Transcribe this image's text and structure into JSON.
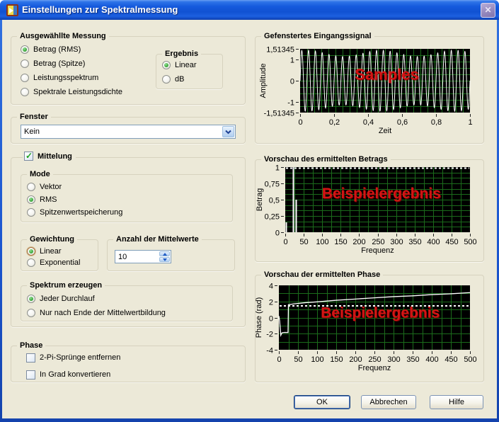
{
  "window": {
    "title": "Einstellungen zur Spektralmessung",
    "close_glyph": "✕"
  },
  "colors": {
    "titlebar_blue": "#1b55cf",
    "dialog_bg": "#ece9d8",
    "plot_bg": "#000000",
    "grid_green": "#1b6b1b",
    "trace_white": "#ffffff",
    "overlay_red": "#d41414",
    "control_border_blue": "#7f9db9",
    "radio_dot_green": "#2f9e2f",
    "check_green": "#1ea11e"
  },
  "left": {
    "messung": {
      "title": "Ausgewähllte Messung",
      "options": [
        {
          "label": "Betrag (RMS)",
          "selected": true
        },
        {
          "label": "Betrag (Spitze)",
          "selected": false
        },
        {
          "label": "Leistungsspektrum",
          "selected": false
        },
        {
          "label": "Spektrale Leistungsdichte",
          "selected": false
        }
      ]
    },
    "ergebnis": {
      "title": "Ergebnis",
      "options": [
        {
          "label": "Linear",
          "selected": true
        },
        {
          "label": "dB",
          "selected": false
        }
      ]
    },
    "fenster": {
      "title": "Fenster",
      "value": "Kein"
    },
    "mittelung": {
      "label": "Mittelung",
      "checked": true,
      "mode": {
        "title": "Mode",
        "options": [
          {
            "label": "Vektor",
            "selected": false
          },
          {
            "label": "RMS",
            "selected": true
          },
          {
            "label": "Spitzenwertspeicherung",
            "selected": false
          }
        ]
      },
      "gewichtung": {
        "title": "Gewichtung",
        "options": [
          {
            "label": "Linear",
            "selected": true,
            "focused": true
          },
          {
            "label": "Exponential",
            "selected": false
          }
        ]
      },
      "anzahl": {
        "title": "Anzahl der Mittelwerte",
        "value": "10"
      },
      "spektrum": {
        "title": "Spektrum erzeugen",
        "options": [
          {
            "label": "Jeder Durchlauf",
            "selected": true
          },
          {
            "label": "Nur nach Ende der Mittelwertbildung",
            "selected": false
          }
        ]
      }
    },
    "phase": {
      "title": "Phase",
      "options": [
        {
          "label": "2-Pi-Sprünge entfernen",
          "checked": false
        },
        {
          "label": "In Grad konvertieren",
          "checked": false
        }
      ]
    }
  },
  "buttons": {
    "ok": "OK",
    "cancel": "Abbrechen",
    "help": "Hilfe"
  },
  "chart_data": [
    {
      "type": "line",
      "title": "Gefenstertes Eingangssignal",
      "xlabel": "Zeit",
      "ylabel": "Amplitude",
      "xlim": [
        0,
        1
      ],
      "ylim": [
        -1.51345,
        1.51345
      ],
      "xticks": [
        [
          0,
          "0"
        ],
        [
          0.2,
          "0,2"
        ],
        [
          0.4,
          "0,4"
        ],
        [
          0.6,
          "0,6"
        ],
        [
          0.8,
          "0,8"
        ],
        [
          1,
          "1"
        ]
      ],
      "yticks": [
        [
          1.51345,
          "1,51345"
        ],
        [
          1,
          "1"
        ],
        [
          0,
          "0"
        ],
        [
          -1,
          "-1"
        ],
        [
          -1.51345,
          "-1,51345"
        ]
      ],
      "grid": {
        "nx": 24,
        "ny": 10,
        "on": true
      },
      "legend": false,
      "series": [
        {
          "name": "windowed-signal",
          "gen": "sine",
          "cycles": 25,
          "amplitude": 1.3,
          "beat_amp": 0.15,
          "beat_cycles": 2.3,
          "samples": 720
        }
      ],
      "overlay": {
        "text": "Samples",
        "fx": 0.51,
        "fy": 0.4,
        "size": 22
      }
    },
    {
      "type": "line",
      "title": "Vorschau des ermittelten Betrags",
      "xlabel": "Frequenz",
      "ylabel": "Betrag",
      "xlim": [
        0,
        500
      ],
      "ylim": [
        0,
        1
      ],
      "xticks": [
        [
          0,
          "0"
        ],
        [
          50,
          "50"
        ],
        [
          100,
          "100"
        ],
        [
          150,
          "150"
        ],
        [
          200,
          "200"
        ],
        [
          250,
          "250"
        ],
        [
          300,
          "300"
        ],
        [
          350,
          "350"
        ],
        [
          400,
          "400"
        ],
        [
          450,
          "450"
        ],
        [
          500,
          "500"
        ]
      ],
      "yticks": [
        [
          1,
          "1"
        ],
        [
          0.75,
          "0,75"
        ],
        [
          0.5,
          "0,5"
        ],
        [
          0.25,
          "0,25"
        ],
        [
          0,
          "0"
        ]
      ],
      "grid": {
        "nx": 20,
        "ny": 12,
        "on": true
      },
      "legend": false,
      "series": [
        {
          "name": "betrag-spektrum",
          "gen": "spikes",
          "spikes": [
            [
              3,
              0.15
            ],
            [
              22,
              1.0
            ],
            [
              30,
              0.5
            ]
          ]
        },
        {
          "name": "referenzlinie",
          "gen": "hline",
          "y": 1.0,
          "style": "dotted"
        }
      ],
      "overlay": {
        "text": "Beispielergebnis",
        "fx": 0.52,
        "fy": 0.4,
        "size": 21
      }
    },
    {
      "type": "line",
      "title": "Vorschau der ermittelten Phase",
      "xlabel": "Frequenz",
      "ylabel": "Phase (rad)",
      "xlim": [
        0,
        500
      ],
      "ylim": [
        -4,
        4
      ],
      "xticks": [
        [
          0,
          "0"
        ],
        [
          50,
          "50"
        ],
        [
          100,
          "100"
        ],
        [
          150,
          "150"
        ],
        [
          200,
          "200"
        ],
        [
          250,
          "250"
        ],
        [
          300,
          "300"
        ],
        [
          350,
          "350"
        ],
        [
          400,
          "400"
        ],
        [
          450,
          "450"
        ],
        [
          500,
          "500"
        ]
      ],
      "yticks": [
        [
          4,
          "4"
        ],
        [
          2,
          "2"
        ],
        [
          0,
          "0"
        ],
        [
          -2,
          "-2"
        ],
        [
          -4,
          "-4"
        ]
      ],
      "grid": {
        "nx": 20,
        "ny": 8,
        "on": true
      },
      "legend": false,
      "series": [
        {
          "name": "phase",
          "gen": "points",
          "points": [
            [
              0,
              0.2
            ],
            [
              2,
              -0.4
            ],
            [
              5,
              -2.2
            ],
            [
              8,
              -1.9
            ],
            [
              14,
              -1.85
            ],
            [
              24,
              -1.85
            ],
            [
              25,
              1.6
            ],
            [
              40,
              1.7
            ],
            [
              70,
              1.85
            ],
            [
              100,
              1.95
            ],
            [
              150,
              2.15
            ],
            [
              200,
              2.3
            ],
            [
              250,
              2.45
            ],
            [
              300,
              2.6
            ],
            [
              350,
              2.7
            ],
            [
              400,
              2.85
            ],
            [
              450,
              2.95
            ],
            [
              500,
              3.1
            ]
          ]
        },
        {
          "name": "referenzlinie",
          "gen": "hline",
          "y": 1.45,
          "style": "dotted"
        }
      ],
      "overlay": {
        "text": "Beispielergebnis",
        "fx": 0.53,
        "fy": 0.42,
        "size": 21
      }
    }
  ]
}
